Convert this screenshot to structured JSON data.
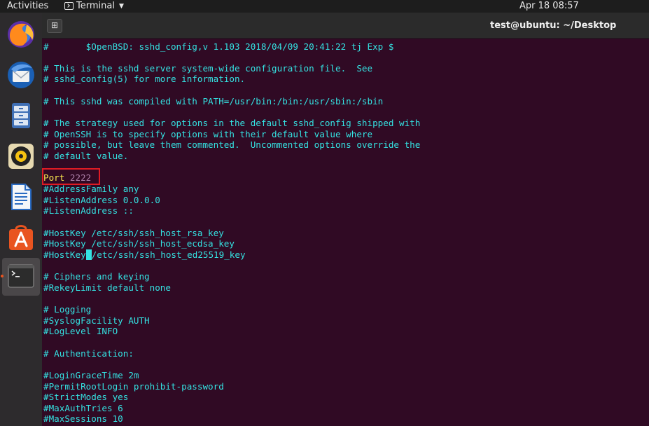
{
  "topbar": {
    "activities": "Activities",
    "app_name": "Terminal",
    "clock": "Apr 18  08:57"
  },
  "dock": {
    "items": [
      "firefox-icon",
      "thunderbird-icon",
      "files-icon",
      "rhythmbox-icon",
      "libreoffice-writer-icon",
      "ubuntu-software-icon",
      "terminal-icon"
    ]
  },
  "window": {
    "title": "test@ubuntu: ~/Desktop",
    "new_tab_glyph": "⊞"
  },
  "terminal": {
    "lines": {
      "l01": "#       $OpenBSD: sshd_config,v 1.103 2018/04/09 20:41:22 tj Exp $",
      "l02": "# This is the sshd server system-wide configuration file.  See",
      "l03": "# sshd_config(5) for more information.",
      "l04": "# This sshd was compiled with PATH=/usr/bin:/bin:/usr/sbin:/sbin",
      "l05": "# The strategy used for options in the default sshd_config shipped with",
      "l06": "# OpenSSH is to specify options with their default value where",
      "l07": "# possible, but leave them commented.  Uncommented options override the",
      "l08": "# default value.",
      "port_keyword": "Port",
      "port_value": " 2222",
      "l10": "#AddressFamily any",
      "l11": "#ListenAddress 0.0.0.0",
      "l12": "#ListenAddress ::",
      "l13": "#HostKey /etc/ssh/ssh_host_rsa_key",
      "l14": "#HostKey /etc/ssh/ssh_host_ecdsa_key",
      "l15a": "#HostKey",
      "l15b": "/etc/ssh/ssh_host_ed25519_key",
      "l16": "# Ciphers and keying",
      "l17": "#RekeyLimit default none",
      "l18": "# Logging",
      "l19": "#SyslogFacility AUTH",
      "l20": "#LogLevel INFO",
      "l21": "# Authentication:",
      "l22": "#LoginGraceTime 2m",
      "l23": "#PermitRootLogin prohibit-password",
      "l24": "#StrictModes yes",
      "l25": "#MaxAuthTries 6",
      "l26": "#MaxSessions 10"
    }
  },
  "colors": {
    "terminal_bg": "#300a24",
    "comment_text": "#34e2e2",
    "keyword": "#fce94f",
    "value": "#ad7fa8",
    "highlight_box": "#e01b24"
  }
}
